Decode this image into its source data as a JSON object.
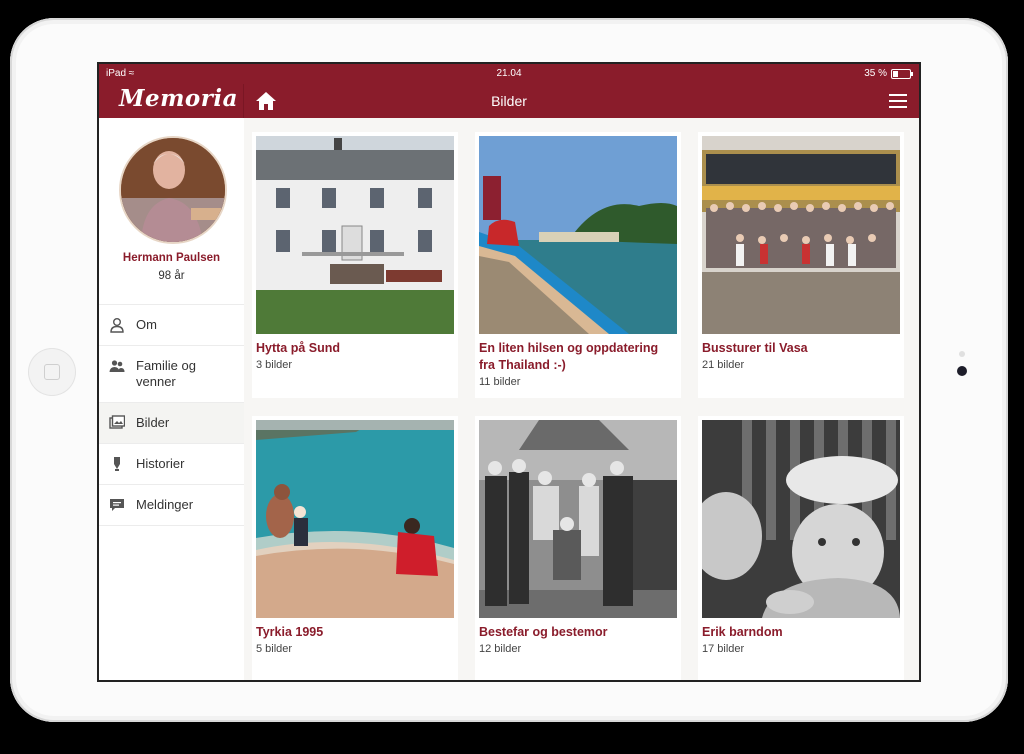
{
  "status": {
    "device": "iPad",
    "time": "21.04",
    "battery": "35 %"
  },
  "app": {
    "logo": "Memoria",
    "title": "Bilder"
  },
  "profile": {
    "name": "Hermann Paulsen",
    "age": "98 år"
  },
  "nav": [
    {
      "label": "Om",
      "icon": "person-icon"
    },
    {
      "label": "Familie og venner",
      "icon": "people-icon"
    },
    {
      "label": "Bilder",
      "icon": "photos-icon",
      "active": true
    },
    {
      "label": "Historier",
      "icon": "pen-icon"
    },
    {
      "label": "Meldinger",
      "icon": "chat-icon"
    }
  ],
  "albums": [
    {
      "title": "Hytta på Sund",
      "count": "3 bilder"
    },
    {
      "title": "En liten hilsen og oppdatering fra Thailand :-)",
      "count": "11 bilder"
    },
    {
      "title": "Bussturer til Vasa",
      "count": "21 bilder"
    },
    {
      "title": "Tyrkia 1995",
      "count": "5 bilder"
    },
    {
      "title": "Bestefar og bestemor",
      "count": "12 bilder"
    },
    {
      "title": "Erik barndom",
      "count": "17 bilder"
    }
  ],
  "colors": {
    "brand": "#8a1c2b",
    "background": "#f7f6f4"
  }
}
